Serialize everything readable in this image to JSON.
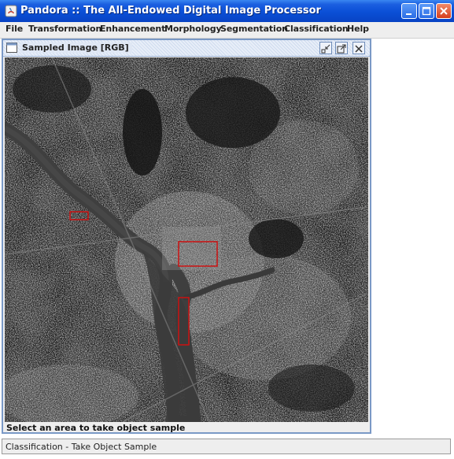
{
  "window": {
    "title": "Pandora :: The All-Endowed Digital Image Processor",
    "title_bar_color": "#0a4fd6",
    "close_button_color": "#d6401e"
  },
  "menu": {
    "items": [
      "File",
      "Transformation",
      "Enhancement",
      "Morphology",
      "Segmentation",
      "Classification",
      "Help"
    ]
  },
  "internal_frame": {
    "title": "Sampled Image [RGB]",
    "status_text": "Select an area to take object sample",
    "icons": [
      "window-icon",
      "iconify-icon",
      "maximize-icon",
      "close-icon"
    ]
  },
  "image": {
    "description_icon": "satellite-image",
    "sample_box_color": "#cc1111",
    "sample_boxes": 3
  },
  "status_bar": {
    "text": "Classification - Take Object Sample"
  }
}
